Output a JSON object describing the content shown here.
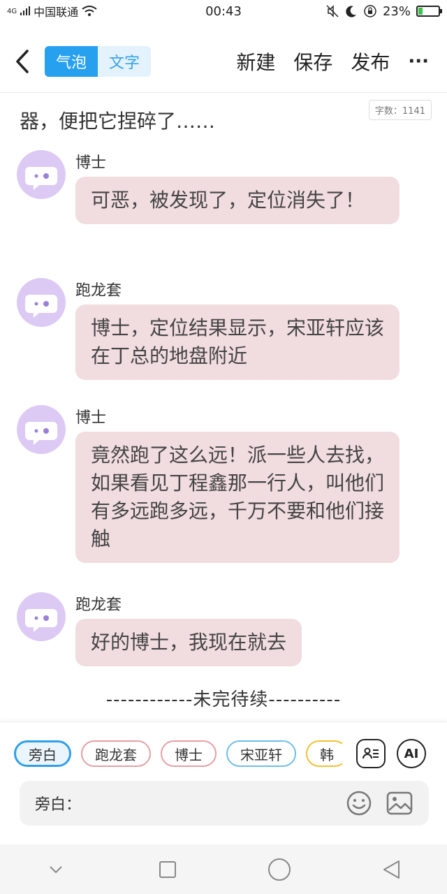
{
  "status_bar": {
    "network": "4G",
    "carrier": "中国联通",
    "time": "00:43",
    "battery": "23%",
    "battery_level": 0.23
  },
  "header": {
    "segments": [
      {
        "label": "气泡",
        "active": true
      },
      {
        "label": "文字",
        "active": false
      }
    ],
    "new_label": "新建",
    "save_label": "保存",
    "publish_label": "发布",
    "more_label": "···"
  },
  "prev_text": "器，便把它捏碎了……",
  "word_count": "字数：1141",
  "messages": [
    {
      "name": "博士",
      "text": "可恶，被发现了，定位消失了！"
    },
    {
      "name": "跑龙套",
      "text": "博士，定位结果显示，宋亚轩应该在丁总的地盘附近"
    },
    {
      "name": "博士",
      "text": "竟然跑了这么远！派一些人去找，如果看见丁程鑫那一行人，叫他们有多远跑多远，千万不要和他们接触"
    },
    {
      "name": "跑龙套",
      "text": "好的博士，我现在就去"
    }
  ],
  "to_be_continued": "------------未完待续----------",
  "panel": {
    "chips": [
      "旁白",
      "跑龙套",
      "博士",
      "宋亚轩",
      "韩"
    ],
    "ai_label": "AI",
    "input_label": "旁白：",
    "input_value": ""
  },
  "icons": {
    "back": "chevron-left-icon",
    "role": "role-card-icon",
    "emoji": "smiley-icon",
    "image": "image-icon"
  },
  "colors": {
    "accent": "#27a0ef",
    "bubble": "#f1dcdf",
    "avatar": "#dccaf5"
  }
}
